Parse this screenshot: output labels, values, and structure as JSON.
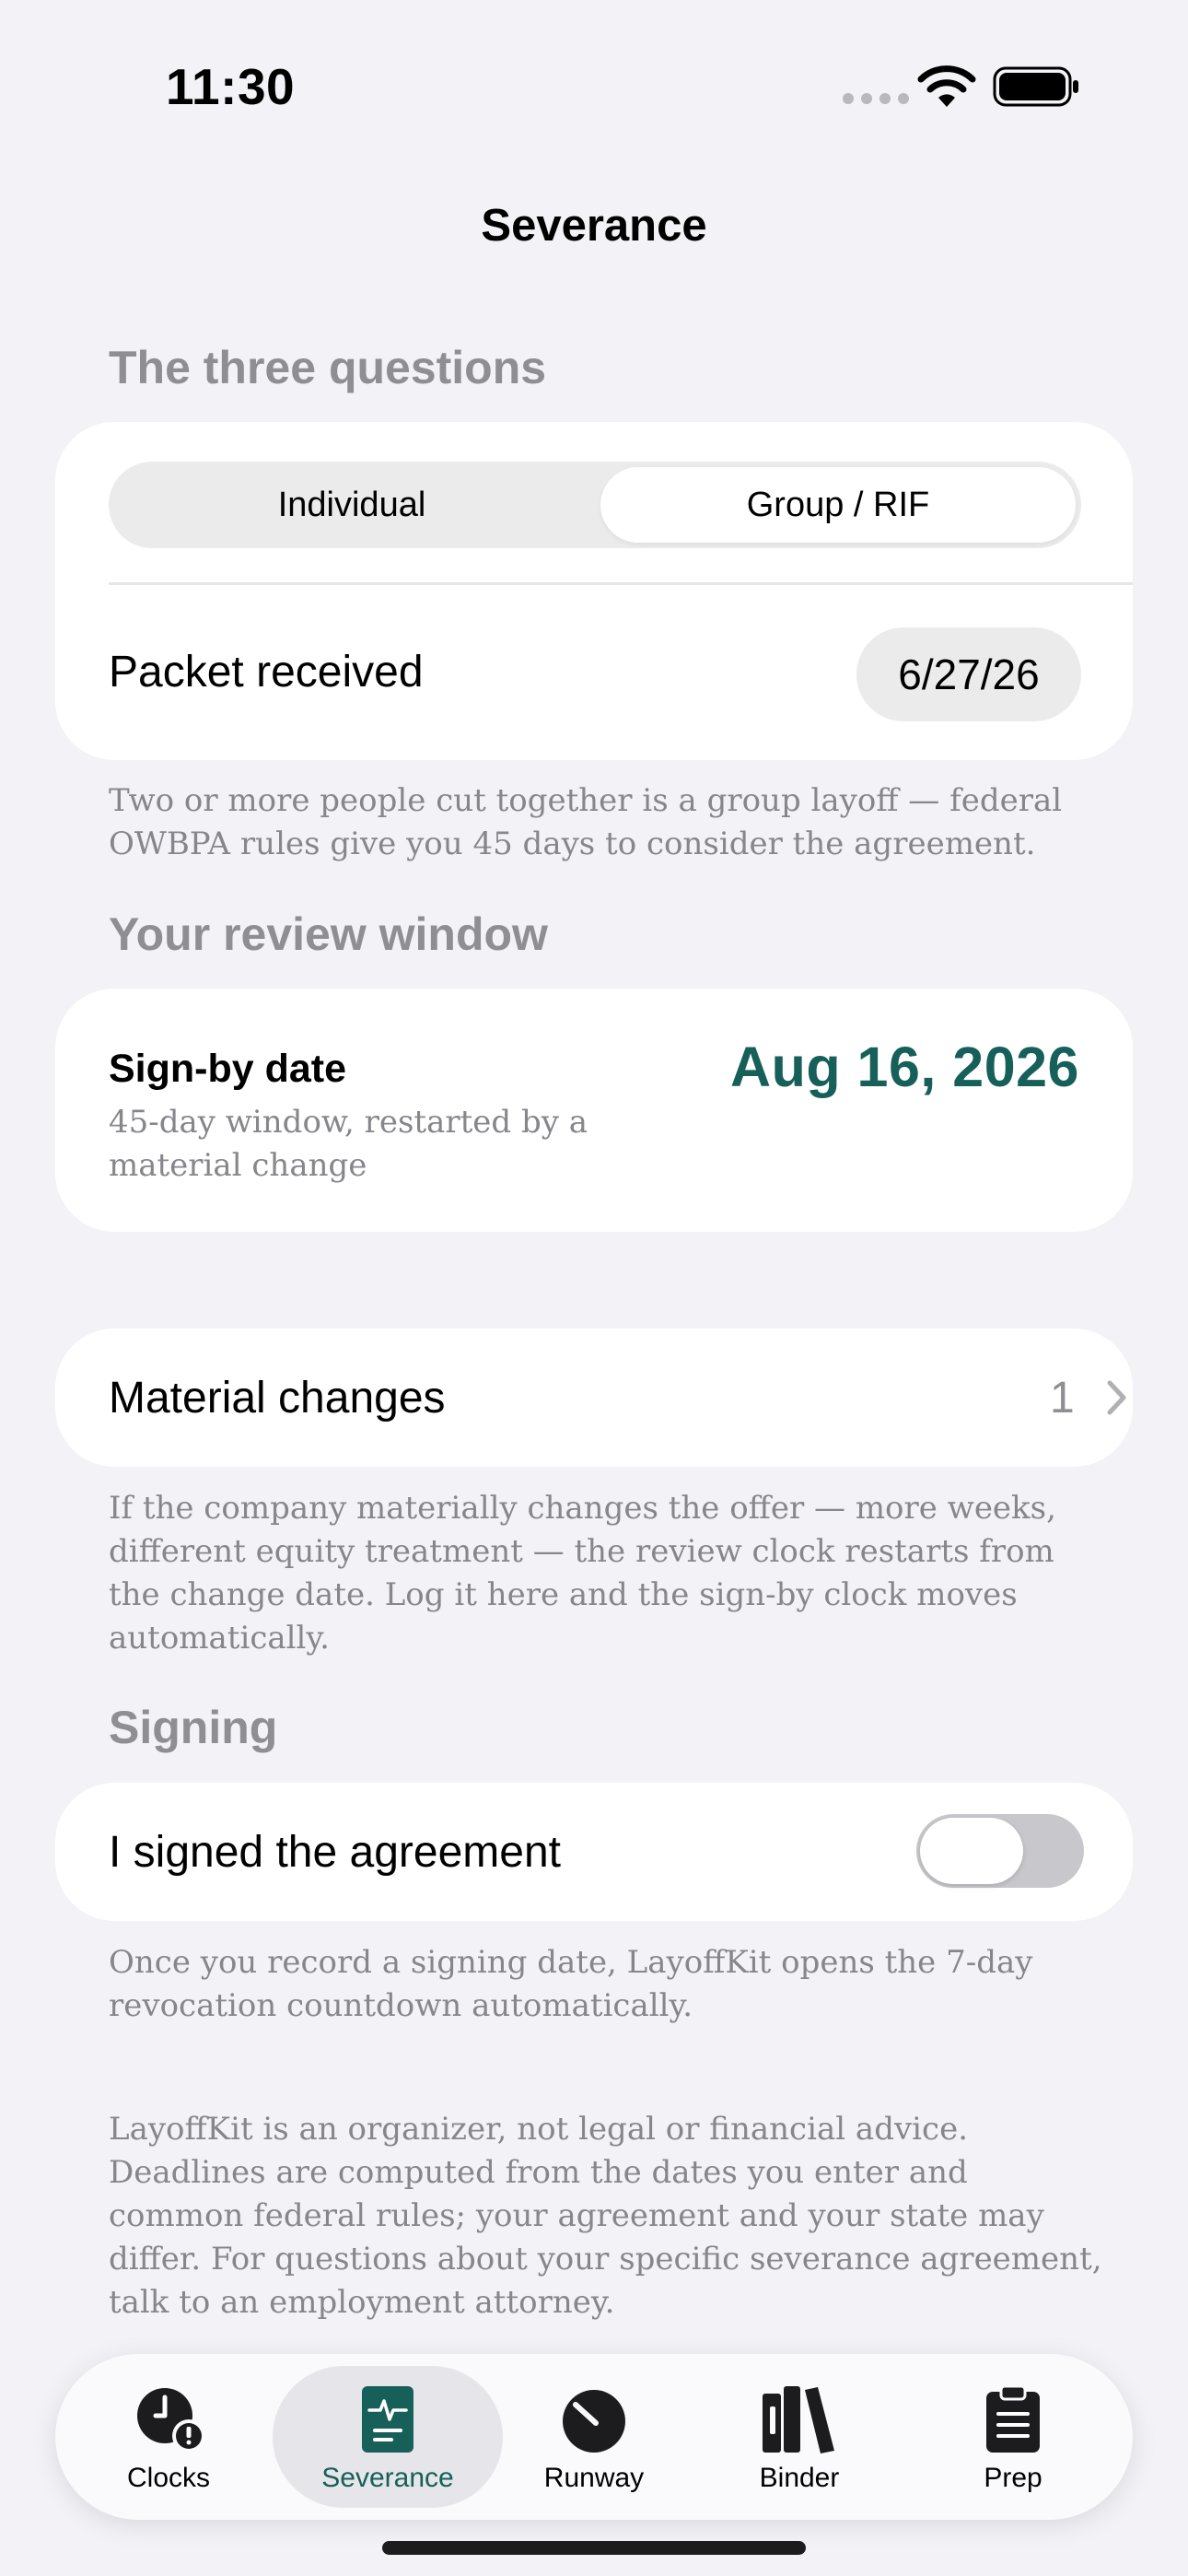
{
  "status_bar": {
    "time": "11:30"
  },
  "nav": {
    "title": "Severance"
  },
  "three_questions": {
    "header": "The three questions",
    "segments": [
      "Individual",
      "Group / RIF"
    ],
    "selected_segment": "Group / RIF",
    "packet_label": "Packet received",
    "packet_date": "6/27/26",
    "footnote": "Two or more people cut together is a group layoff — federal OWBPA rules give you 45 days to consider the agreement."
  },
  "review_window": {
    "header": "Your review window",
    "signby_label": "Sign-by date",
    "signby_subtitle": "45-day window, restarted by a material change",
    "signby_date": "Aug 16, 2026"
  },
  "material_changes": {
    "label": "Material changes",
    "count": "1",
    "footnote": "If the company materially changes the offer — more weeks, different equity treatment — the review clock restarts from the change date. Log it here and the sign-by clock moves automatically."
  },
  "signing": {
    "header": "Signing",
    "toggle_label": "I signed the agreement",
    "toggle_on": false,
    "footnote": "Once you record a signing date, LayoffKit opens the 7-day revocation countdown automatically."
  },
  "disclaimer": "LayoffKit is an organizer, not legal or financial advice. Deadlines are computed from the dates you enter and common federal rules; your agreement and your state may differ. For questions about your specific severance agreement, talk to an employment attorney.",
  "tabs": [
    {
      "label": "Clocks",
      "icon": "clock-alert-icon"
    },
    {
      "label": "Severance",
      "icon": "document-pulse-icon"
    },
    {
      "label": "Runway",
      "icon": "gauge-icon"
    },
    {
      "label": "Binder",
      "icon": "books-icon"
    },
    {
      "label": "Prep",
      "icon": "clipboard-icon"
    }
  ],
  "active_tab": "Severance",
  "colors": {
    "accent": "#17605a",
    "background": "#f2f2f7",
    "secondary_text": "#8e8e93"
  }
}
